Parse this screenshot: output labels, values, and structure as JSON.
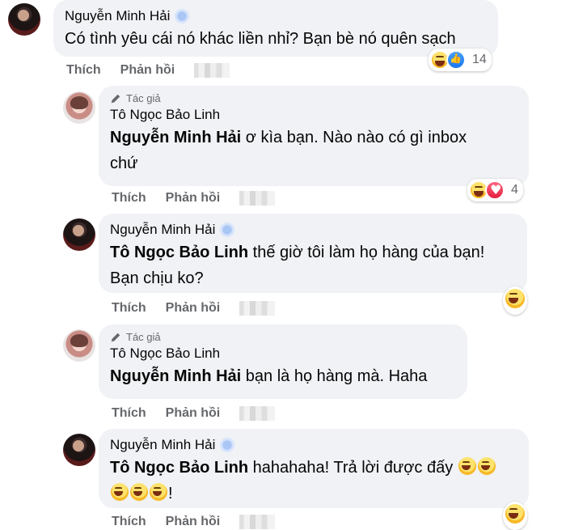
{
  "comments": [
    {
      "author": "Nguyễn Minh Hải",
      "text": "Có tình yêu cái nó khác liền nhỉ? Bạn bè nó quên sạch",
      "like_label": "Thích",
      "reply_label": "Phản hồi",
      "reaction_count": "14"
    },
    {
      "author_tag": "Tác giả",
      "author": "Tô Ngọc Bảo Linh",
      "mention": "Nguyễn Minh Hải",
      "text_line1": " ơ kìa bạn. Nào nào có gì inbox",
      "text_line2": "chứ",
      "like_label": "Thích",
      "reply_label": "Phản hồi",
      "reaction_count": "4"
    },
    {
      "author": "Nguyễn Minh Hải",
      "mention": "Tô Ngọc Bảo Linh",
      "text_line1": " thế giờ tôi làm họ hàng của bạn!",
      "text_line2": "Bạn chịu ko?",
      "like_label": "Thích",
      "reply_label": "Phản hồi"
    },
    {
      "author_tag": "Tác giả",
      "author": "Tô Ngọc Bảo Linh",
      "mention": "Nguyễn Minh Hải",
      "text": " bạn là họ hàng mà. Haha",
      "like_label": "Thích",
      "reply_label": "Phản hồi"
    },
    {
      "author": "Nguyễn Minh Hải",
      "mention": "Tô Ngọc Bảo Linh",
      "text_line1": " hahahaha! Trả lời được đấy ",
      "text_line2_suffix": "!",
      "like_label": "Thích",
      "reply_label": "Phản hồi"
    }
  ],
  "icons": {
    "author_tag_icon": "pencil-icon",
    "verified_badge": "verified-badge",
    "reaction_haha": "haha-emoji-icon",
    "reaction_like": "like-icon",
    "reaction_love": "love-icon"
  }
}
